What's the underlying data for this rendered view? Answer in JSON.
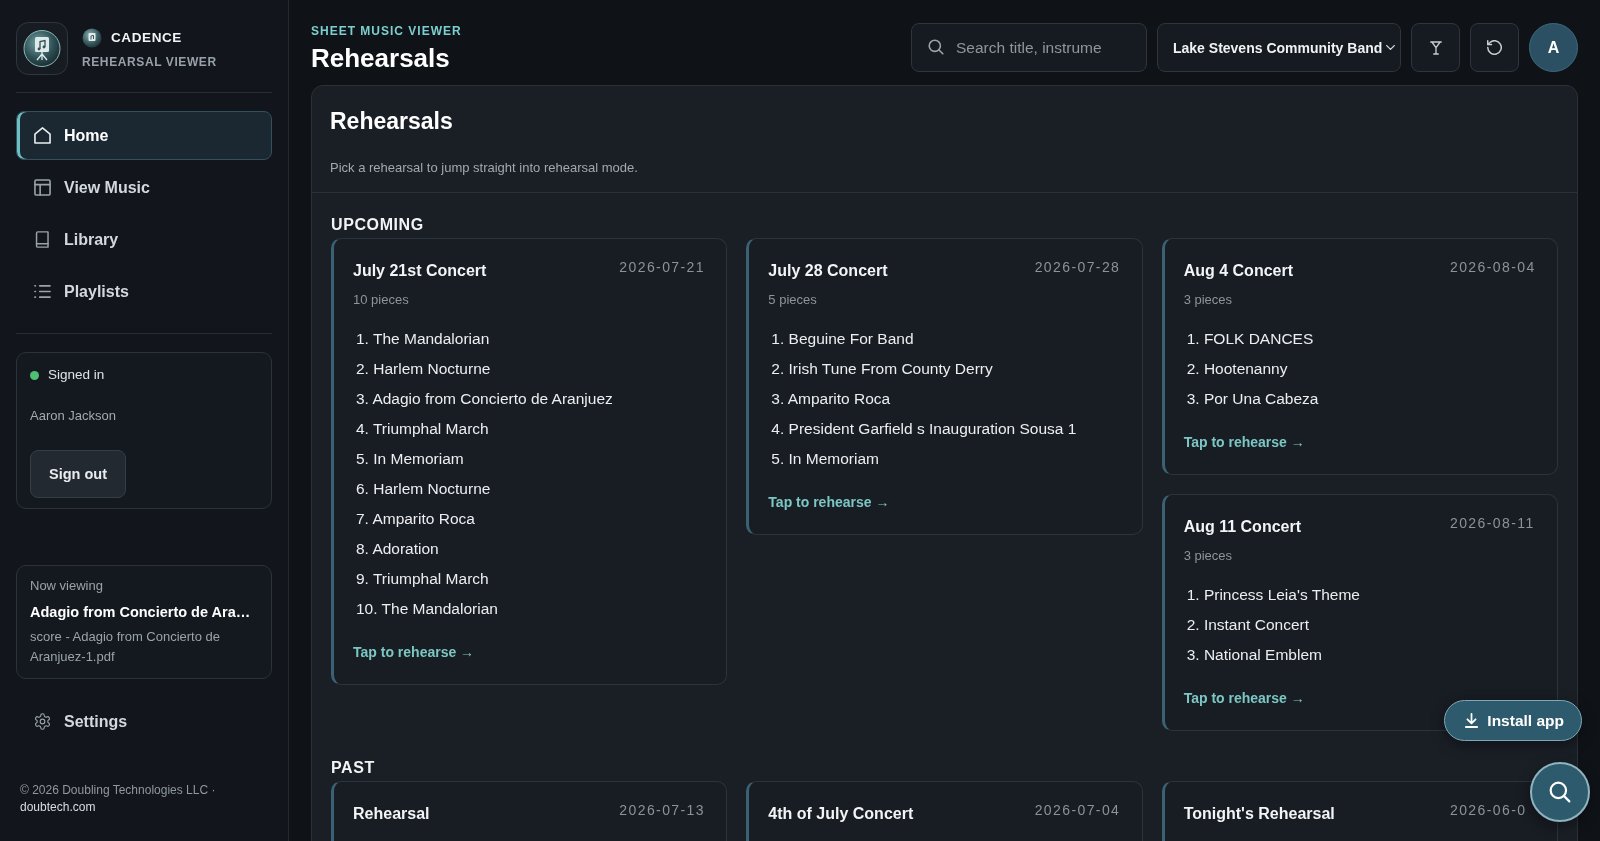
{
  "sidebar": {
    "brand": {
      "name": "CADENCE",
      "tagline": "REHEARSAL VIEWER"
    },
    "nav": [
      {
        "label": "Home",
        "selected": true
      },
      {
        "label": "View Music",
        "selected": false
      },
      {
        "label": "Library",
        "selected": false
      },
      {
        "label": "Playlists",
        "selected": false
      }
    ],
    "account": {
      "status": "Signed in",
      "online": true,
      "user": "Aaron Jackson",
      "action": "Sign out"
    },
    "now_viewing": {
      "label": "Now viewing",
      "title": "Adagio from Concierto de Ara…",
      "file": "score - Adagio from Concierto de Aranjuez-1.pdf"
    },
    "settings": {
      "label": "Settings",
      "selected": false
    },
    "footer": {
      "text": "© 2026 Doubling Technologies LLC ·",
      "link": "doubtech.com"
    }
  },
  "header": {
    "eyebrow": "SHEET MUSIC VIEWER",
    "title": "Rehearsals",
    "search": {
      "placeholder": "Search title, instrume"
    },
    "band_select": {
      "value": "Lake Stevens Community Band"
    },
    "avatar": "A"
  },
  "panel": {
    "title": "Rehearsals",
    "subtitle": "Pick a rehearsal to jump straight into rehearsal mode.",
    "sections": [
      {
        "label": "UPCOMING",
        "rehearsals": [
          {
            "title": "July 21st Concert",
            "date": "2026-07-21",
            "count": "10 pieces",
            "pieces": [
              {
                "number": "1.",
                "title": "The Mandalorian"
              },
              {
                "number": "2.",
                "title": "Harlem Nocturne"
              },
              {
                "number": "3.",
                "title": "Adagio from Concierto de Aranjuez"
              },
              {
                "number": "4.",
                "title": "Triumphal March"
              },
              {
                "number": "5.",
                "title": "In Memoriam"
              },
              {
                "number": "6.",
                "title": "Harlem Nocturne"
              },
              {
                "number": "7.",
                "title": "Amparito Roca"
              },
              {
                "number": "8.",
                "title": "Adoration"
              },
              {
                "number": "9.",
                "title": "Triumphal March"
              },
              {
                "number": "10.",
                "title": "The Mandalorian"
              }
            ],
            "action": "Tap to rehearse →"
          },
          {
            "title": "July 28 Concert",
            "date": "2026-07-28",
            "count": "5 pieces",
            "pieces": [
              {
                "number": "1.",
                "title": "Beguine For Band"
              },
              {
                "number": "2.",
                "title": "Irish Tune From County Derry"
              },
              {
                "number": "3.",
                "title": "Amparito Roca"
              },
              {
                "number": "4.",
                "title": "President Garfield s Inauguration Sousa 1"
              },
              {
                "number": "5.",
                "title": "In Memoriam"
              }
            ],
            "action": "Tap to rehearse →"
          },
          {
            "title": "Aug 4 Concert",
            "date": "2026-08-04",
            "count": "3 pieces",
            "pieces": [
              {
                "number": "1.",
                "title": "FOLK DANCES"
              },
              {
                "number": "2.",
                "title": "Hootenanny"
              },
              {
                "number": "3.",
                "title": "Por Una Cabeza"
              }
            ],
            "action": "Tap to rehearse →"
          },
          {
            "title": "Aug 11 Concert",
            "date": "2026-08-11",
            "count": "3 pieces",
            "pieces": [
              {
                "number": "1.",
                "title": "Princess Leia's Theme"
              },
              {
                "number": "2.",
                "title": "Instant Concert"
              },
              {
                "number": "3.",
                "title": "National Emblem"
              }
            ],
            "action": "Tap to rehearse →"
          }
        ]
      },
      {
        "label": "PAST",
        "rehearsals": [
          {
            "title": "Rehearsal",
            "date": "2026-07-13"
          },
          {
            "title": "4th of July Concert",
            "date": "2026-07-04"
          },
          {
            "title": "Tonight's Rehearsal",
            "date": "2026-06-0"
          }
        ]
      }
    ]
  },
  "install_button": "Install app"
}
